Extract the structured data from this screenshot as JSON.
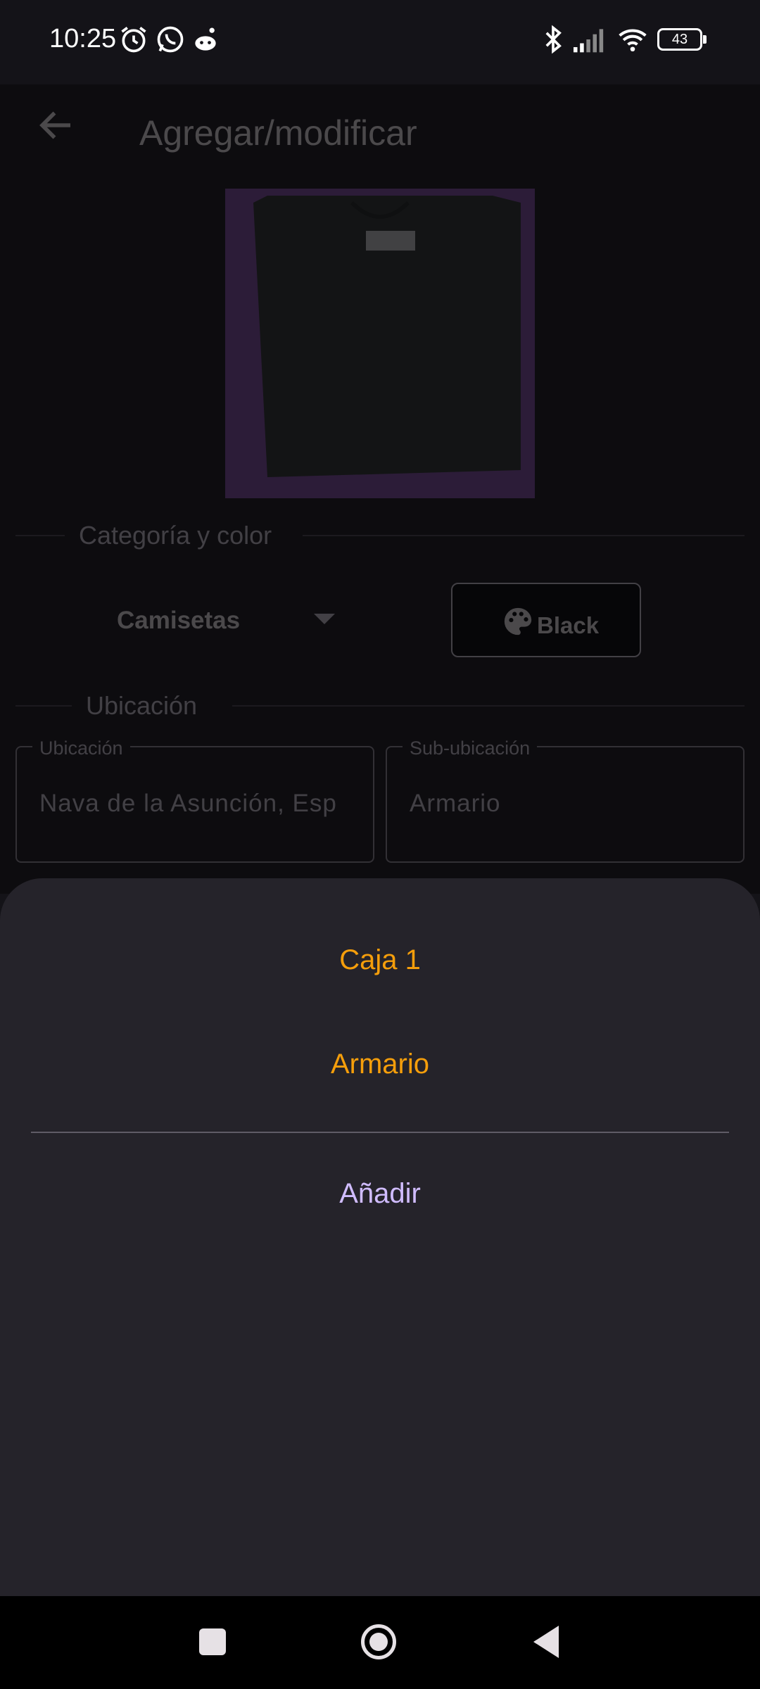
{
  "status_bar": {
    "time": "10:25",
    "battery": "43",
    "icons": [
      "alarm-icon",
      "whatsapp-icon",
      "reddit-icon",
      "bluetooth-icon",
      "signal-icon",
      "wifi-icon",
      "battery-icon"
    ]
  },
  "app_bar": {
    "title": "Agregar/modificar",
    "back_icon": "arrow-back-icon"
  },
  "section_category": {
    "label": "Categoría y color",
    "category_value": "Camisetas",
    "color_button_label": "Black",
    "color_icon": "palette-icon"
  },
  "section_location": {
    "label": "Ubicación",
    "location_field": {
      "label": "Ubicación",
      "value": "Nava de la Asunción, Esp"
    },
    "sublocation_field": {
      "label": "Sub-ubicación",
      "value": "Armario"
    }
  },
  "bottom_sheet": {
    "options": [
      "Caja 1",
      "Armario"
    ],
    "add_label": "Añadir"
  },
  "colors": {
    "background": "#141318",
    "sheet": "#25232a",
    "option_text": "#f59e0b",
    "add_text": "#d0bcff",
    "photo_bg": "#7e4aa2"
  },
  "nav_bar": {
    "icons": [
      "recents-square-icon",
      "home-circle-icon",
      "back-triangle-icon"
    ]
  }
}
